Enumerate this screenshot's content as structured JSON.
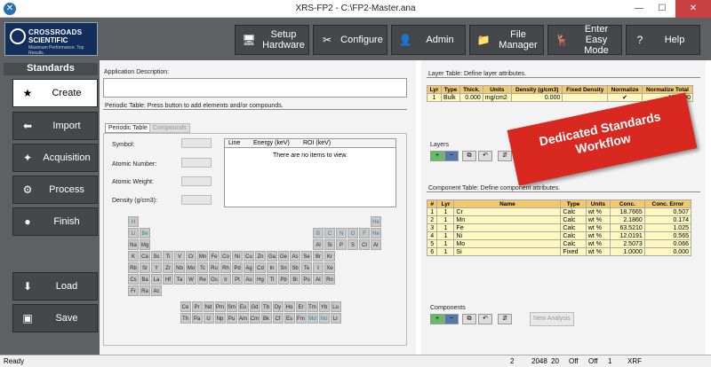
{
  "window": {
    "title": "XRS-FP2 - C:\\FP2-Master.ana",
    "min": "—",
    "max": "☐",
    "close": "✕"
  },
  "logo": {
    "line1": "CROSSROADS",
    "line2": "SCIENTIFIC",
    "line3": "Maximum Performance. Top Results."
  },
  "toolbar": [
    {
      "label": "Setup Hardware",
      "icon": "computer-icon"
    },
    {
      "label": "Configure",
      "icon": "tools-icon"
    },
    {
      "label": "Admin",
      "icon": "person-icon"
    },
    {
      "label": "File Manager",
      "icon": "folder-icon"
    },
    {
      "label": "Enter Easy Mode",
      "icon": "deer-icon"
    },
    {
      "label": "Help",
      "icon": "help-icon"
    }
  ],
  "sidebar": {
    "title": "Standards",
    "items": [
      {
        "label": "Create",
        "icon": "star-icon",
        "active": true
      },
      {
        "label": "Import",
        "icon": "import-icon"
      },
      {
        "label": "Acquisition",
        "icon": "wand-icon"
      },
      {
        "label": "Process",
        "icon": "gear-icon"
      },
      {
        "label": "Finish",
        "icon": "circle-icon"
      },
      {
        "label": "Load",
        "icon": "load-icon"
      },
      {
        "label": "Save",
        "icon": "floppy-icon"
      }
    ]
  },
  "app_description": {
    "label": "Application Description:",
    "value": ""
  },
  "periodic": {
    "hint": "Periodic Table:  Press button to add elements and/or compounds.",
    "tab1": "Periodic Table",
    "tab2": "Compounds",
    "fields": [
      "Symbol:",
      "Atomic Number:",
      "Atomic Weight:",
      "Density (g/cm3):"
    ],
    "list_headers": [
      "Line",
      "Energy (keV)",
      "ROI (keV)"
    ],
    "list_empty": "There are no items to view."
  },
  "layer_table": {
    "title": "Layer Table:  Define layer attributes.",
    "headers": [
      "Lyr",
      "Type",
      "Thick.",
      "Units",
      "Density (g/cm3)",
      "Fixed Density",
      "Normalize",
      "Normalize Total"
    ],
    "row": [
      "1",
      "Bulk",
      "0.000",
      "mg/cm2",
      "0.000",
      "",
      "✔",
      "100.000"
    ]
  },
  "layers_label": "Layers",
  "component_table": {
    "title": "Component Table:  Define component attributes.",
    "headers": [
      "#",
      "Lyr",
      "Name",
      "Type",
      "Units",
      "Conc.",
      "Conc. Error"
    ],
    "rows": [
      [
        "1",
        "1",
        "Cr",
        "Calc",
        "wt %",
        "18.7665",
        "0.507"
      ],
      [
        "2",
        "1",
        "Mn",
        "Calc",
        "wt %",
        "2.1860",
        "0.174"
      ],
      [
        "3",
        "1",
        "Fe",
        "Calc",
        "wt %",
        "63.5210",
        "1.025"
      ],
      [
        "4",
        "1",
        "Ni",
        "Calc",
        "wt %",
        "12.0191",
        "0.565"
      ],
      [
        "5",
        "1",
        "Mo",
        "Calc",
        "wt %",
        "2.5073",
        "0.066"
      ],
      [
        "6",
        "1",
        "Si",
        "Fixed",
        "wt %",
        "1.0000",
        "0.000"
      ]
    ]
  },
  "components_label": "Components",
  "new_analysis": "New Analysis",
  "banner": "Dedicated Standards Workflow",
  "status": {
    "left": "Ready",
    "f1": "2",
    "f2": "2048",
    "f3": "20",
    "f4": "Off",
    "f5": "Off",
    "f6": "1",
    "f7": "XRF"
  },
  "elements": [
    [
      "H",
      "",
      "teal"
    ],
    [
      "He",
      "",
      "teal"
    ],
    [
      "Li",
      "",
      "teal"
    ],
    [
      "Be",
      "",
      "teal"
    ],
    [
      "B",
      "",
      "teal"
    ],
    [
      "C",
      "",
      "teal"
    ],
    [
      "N",
      "",
      "teal"
    ],
    [
      "O",
      "",
      "teal"
    ],
    [
      "F",
      "",
      "teal"
    ],
    [
      "Ne",
      "",
      "teal"
    ],
    [
      "Na"
    ],
    [
      "Mg"
    ],
    [
      "Al"
    ],
    [
      "Si"
    ],
    [
      "P"
    ],
    [
      "S"
    ],
    [
      "Cl"
    ],
    [
      "Ar"
    ],
    [
      "K"
    ],
    [
      "Ca"
    ],
    [
      "Sc"
    ],
    [
      "Ti"
    ],
    [
      "V"
    ],
    [
      "Cr"
    ],
    [
      "Mn"
    ],
    [
      "Fe"
    ],
    [
      "Co"
    ],
    [
      "Ni"
    ],
    [
      "Cu"
    ],
    [
      "Zn"
    ],
    [
      "Ga"
    ],
    [
      "Ge"
    ],
    [
      "As"
    ],
    [
      "Se"
    ],
    [
      "Br"
    ],
    [
      "Kr"
    ],
    [
      "Rb"
    ],
    [
      "Sr"
    ],
    [
      "Y"
    ],
    [
      "Zr"
    ],
    [
      "Nb"
    ],
    [
      "Mo"
    ],
    [
      "Tc"
    ],
    [
      "Ru"
    ],
    [
      "Rh"
    ],
    [
      "Pd"
    ],
    [
      "Ag"
    ],
    [
      "Cd"
    ],
    [
      "In"
    ],
    [
      "Sn"
    ],
    [
      "Sb"
    ],
    [
      "Te"
    ],
    [
      "I"
    ],
    [
      "Xe"
    ],
    [
      "Cs"
    ],
    [
      "Ba"
    ],
    [
      "La"
    ],
    [
      "Hf"
    ],
    [
      "Ta"
    ],
    [
      "W"
    ],
    [
      "Re"
    ],
    [
      "Os"
    ],
    [
      "Ir"
    ],
    [
      "Pt"
    ],
    [
      "Au"
    ],
    [
      "Hg"
    ],
    [
      "Tl"
    ],
    [
      "Pb"
    ],
    [
      "Bi"
    ],
    [
      "Po"
    ],
    [
      "At"
    ],
    [
      "Rn"
    ],
    [
      "Fr"
    ],
    [
      "Ra"
    ],
    [
      "Ac"
    ],
    [
      "Ce"
    ],
    [
      "Pr"
    ],
    [
      "Nd"
    ],
    [
      "Pm"
    ],
    [
      "Sm"
    ],
    [
      "Eu"
    ],
    [
      "Gd"
    ],
    [
      "Tb"
    ],
    [
      "Dy"
    ],
    [
      "Ho"
    ],
    [
      "Er"
    ],
    [
      "Tm"
    ],
    [
      "Yb"
    ],
    [
      "Lu"
    ],
    [
      "Th"
    ],
    [
      "Pa"
    ],
    [
      "U"
    ],
    [
      "Np"
    ],
    [
      "Pu"
    ],
    [
      "Am"
    ],
    [
      "Cm"
    ],
    [
      "Bk"
    ],
    [
      "Cf"
    ],
    [
      "Es"
    ],
    [
      "Fm"
    ],
    [
      "Md",
      "",
      "teal"
    ],
    [
      "No",
      "",
      "teal"
    ],
    [
      "Lr"
    ]
  ]
}
